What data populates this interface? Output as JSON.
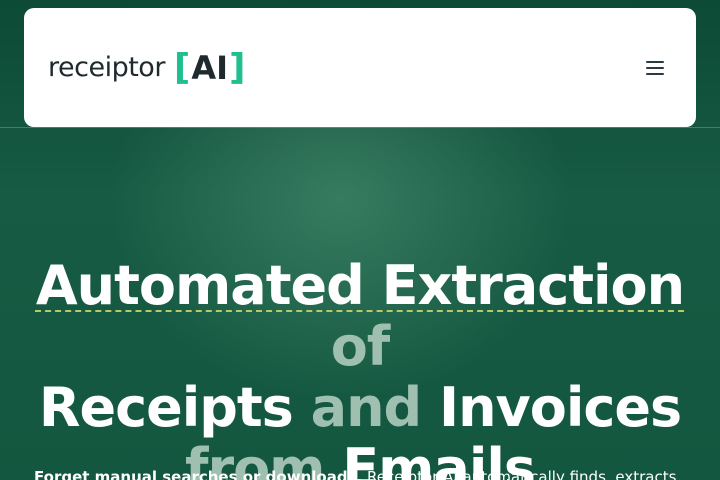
{
  "header": {
    "logo_word": "receiptor",
    "logo_bracket_open": "[",
    "logo_ai": "AI",
    "logo_bracket_close": "]",
    "menu_icon": "hamburger-menu-icon"
  },
  "hero": {
    "line1_a": "Automated Extraction",
    "line1_b": "of",
    "line2_a": "Receipts",
    "line2_b": "and",
    "line2_c": "Invoices",
    "line3_a": "from",
    "line3_b": "Emails"
  },
  "subtitle": {
    "bold": "Forget manual searches or downloads.",
    "rest": " Receiptor AI automatically finds, extracts, and"
  },
  "colors": {
    "brand_green": "#1fbf8f",
    "background": "#0f4a37",
    "muted_text": "#9fbfb1",
    "underline": "#b9c86a"
  }
}
